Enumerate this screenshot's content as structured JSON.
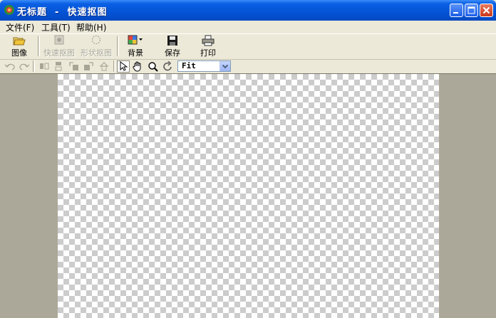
{
  "window": {
    "title": "无标题  -  快速抠图"
  },
  "menu": {
    "file": "文件(F)",
    "tools": "工具(T)",
    "help": "帮助(H)"
  },
  "toolbar": {
    "image": "图像",
    "quick_cutout": "快速抠图",
    "shape_cutout": "形状抠图",
    "background": "背景",
    "save": "保存",
    "print": "打印"
  },
  "zoom": {
    "value": "Fit"
  }
}
